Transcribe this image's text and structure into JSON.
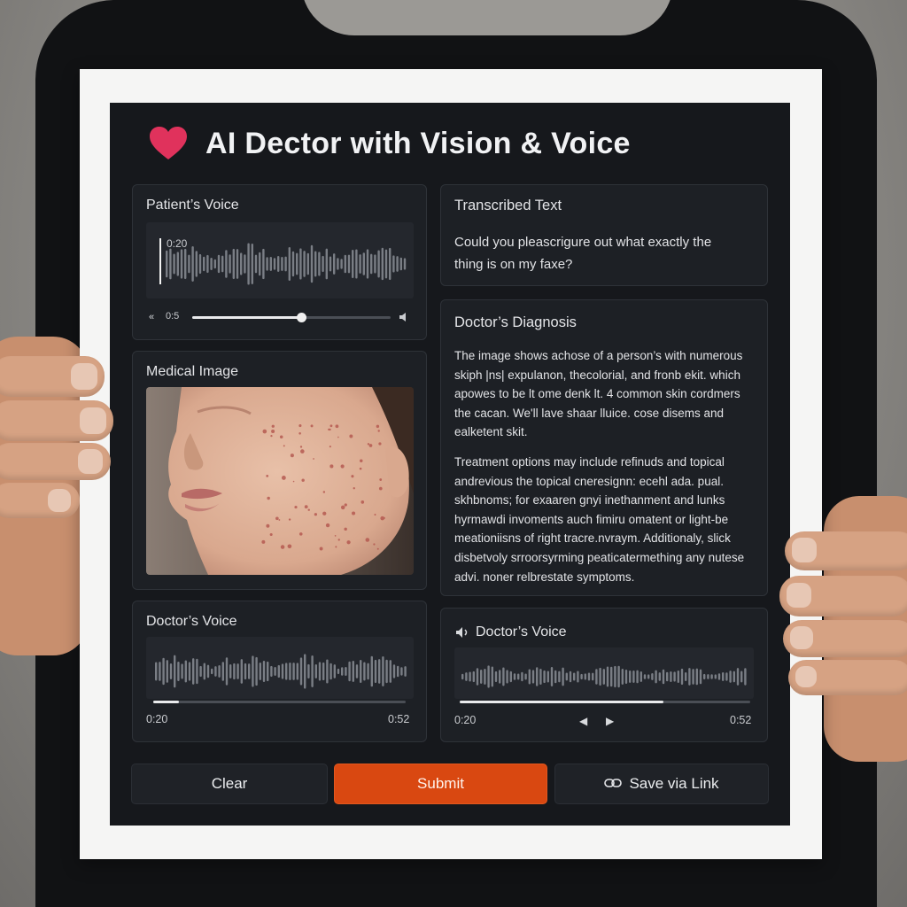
{
  "app": {
    "title": "AI Dector with Vision & Voice"
  },
  "patient_voice": {
    "title": "Patient’s Voice",
    "timestamp": "0:20",
    "current_time": "0:5",
    "progress": 0.55
  },
  "transcribed": {
    "title": "Transcribed Text",
    "text": "Could you pleascrigure out what exactly the thing is on my faxe?"
  },
  "medical_image": {
    "title": "Medical Image"
  },
  "diagnosis": {
    "title": "Doctor’s Diagnosis",
    "paragraph1": "The image shows achose of a person’s with numerous skiph |ns| expulanon, thecolorial, and fronb ekit. which apowes to be lt ome denk lt. 4 common skin cordmers the cacan. We'll lave shaar lluice. cose disems and ealketent skit.",
    "paragraph2": "Treatment options may include refinuds and topical andrevious the topical cneresignn: ecehl ada. pual. skhbnoms; for exaaren gnyi inethanment and lunks hyrmawdi invoments auch fimiru omatent or light-be meationiisns of right tracre.nvraym. Additionaly, slick disbetvoly srroorsyrming peaticatermething any nutese advi. noner relbrestate symptoms."
  },
  "doctor_voice_left": {
    "title": "Doctor’s Voice",
    "time_start": "0:20",
    "time_end": "0:52",
    "progress": 0.1
  },
  "doctor_voice_right": {
    "title": "Doctor’s Voice",
    "time_start": "0:20",
    "time_end": "0:52",
    "progress": 0.7
  },
  "buttons": {
    "clear": "Clear",
    "submit": "Submit",
    "save": "Save via Link"
  },
  "colors": {
    "accent": "#d94811",
    "heart": "#e0325c",
    "app_bg": "#16181c",
    "panel_bg": "#1d2025"
  },
  "icons": [
    "heart-icon",
    "rewind-icon",
    "volume-icon",
    "speaker-icon",
    "previous-icon",
    "play-icon",
    "link-icon"
  ]
}
